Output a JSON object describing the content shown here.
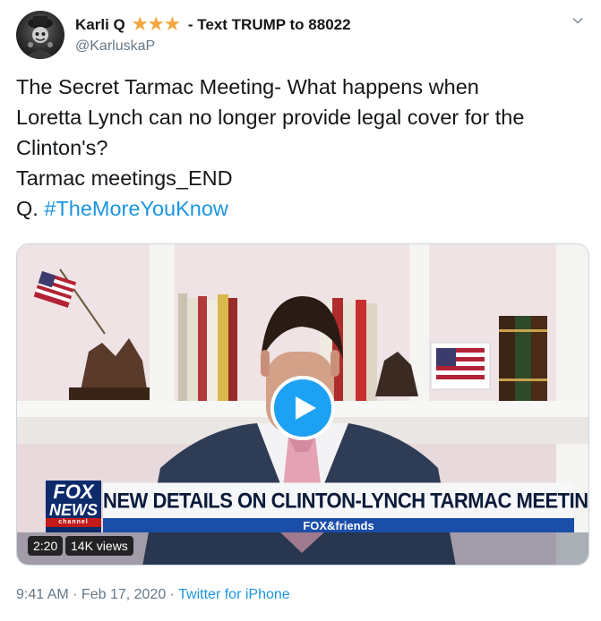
{
  "author": {
    "display_name": "Karli Q",
    "stars": "★★★",
    "name_suffix": "- Text TRUMP to 88022",
    "handle": "@KarluskaP"
  },
  "tweet": {
    "lines": [
      "The Secret Tarmac Meeting- What happens when",
      "Loretta Lynch can no longer provide legal cover for the",
      "Clinton's?",
      "Tarmac meetings_END"
    ],
    "last_line_prefix": "Q. ",
    "hashtag": "#TheMoreYouKnow"
  },
  "video": {
    "chyron_headline": "NEW DETAILS ON CLINTON-LYNCH TARMAC MEETING",
    "chyron_subtitle": "FOX&friends",
    "logo_top": "FOX",
    "logo_bottom": "NEWS",
    "logo_channel": "channel",
    "duration": "2:20",
    "views": "14K views"
  },
  "footer": {
    "time": "9:41 AM",
    "separator": " · ",
    "date": "Feb 17, 2020",
    "source": "Twitter for iPhone"
  },
  "colors": {
    "link": "#1b95e0",
    "star": "#f4a742",
    "play": "#1da1f2",
    "secondary_text": "#657786"
  },
  "icons": {
    "caret": "chevron-down-icon",
    "play": "play-icon"
  }
}
